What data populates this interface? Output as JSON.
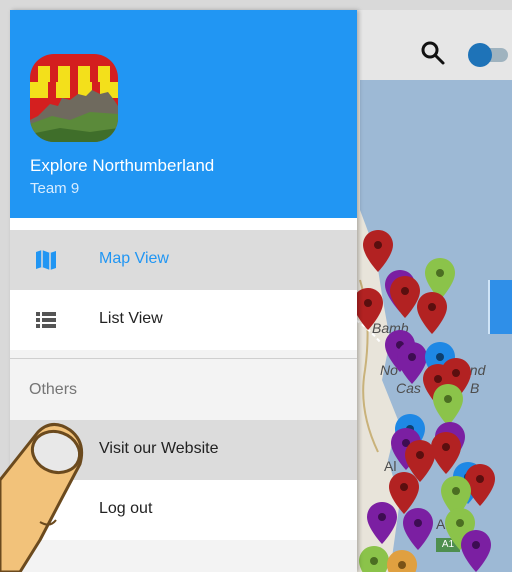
{
  "app": {
    "name": "Explore Northumberland",
    "team": "Team 9"
  },
  "header": {
    "search_icon": "search-icon",
    "toggle_icon": "toggle-switch"
  },
  "menu": {
    "items": [
      {
        "label": "Map View",
        "icon": "map-icon",
        "selected": true
      },
      {
        "label": "List View",
        "icon": "list-icon",
        "selected": false
      }
    ],
    "section_title": "Others",
    "others": [
      {
        "label": "Visit our Website",
        "icon": "web-icon"
      },
      {
        "label": "Log out",
        "icon": "logout-icon"
      }
    ]
  },
  "map": {
    "labels": [
      "Bamb",
      "No",
      "and",
      "Cas",
      "B",
      "Al",
      "Al"
    ],
    "road": "A1"
  },
  "colors": {
    "primary": "#2196f3",
    "selected_bg": "#dcdcdc",
    "marker_red": "#b22222",
    "marker_purple": "#7b1fa2",
    "marker_green": "#8bc34a",
    "marker_blue": "#1e88e5"
  }
}
